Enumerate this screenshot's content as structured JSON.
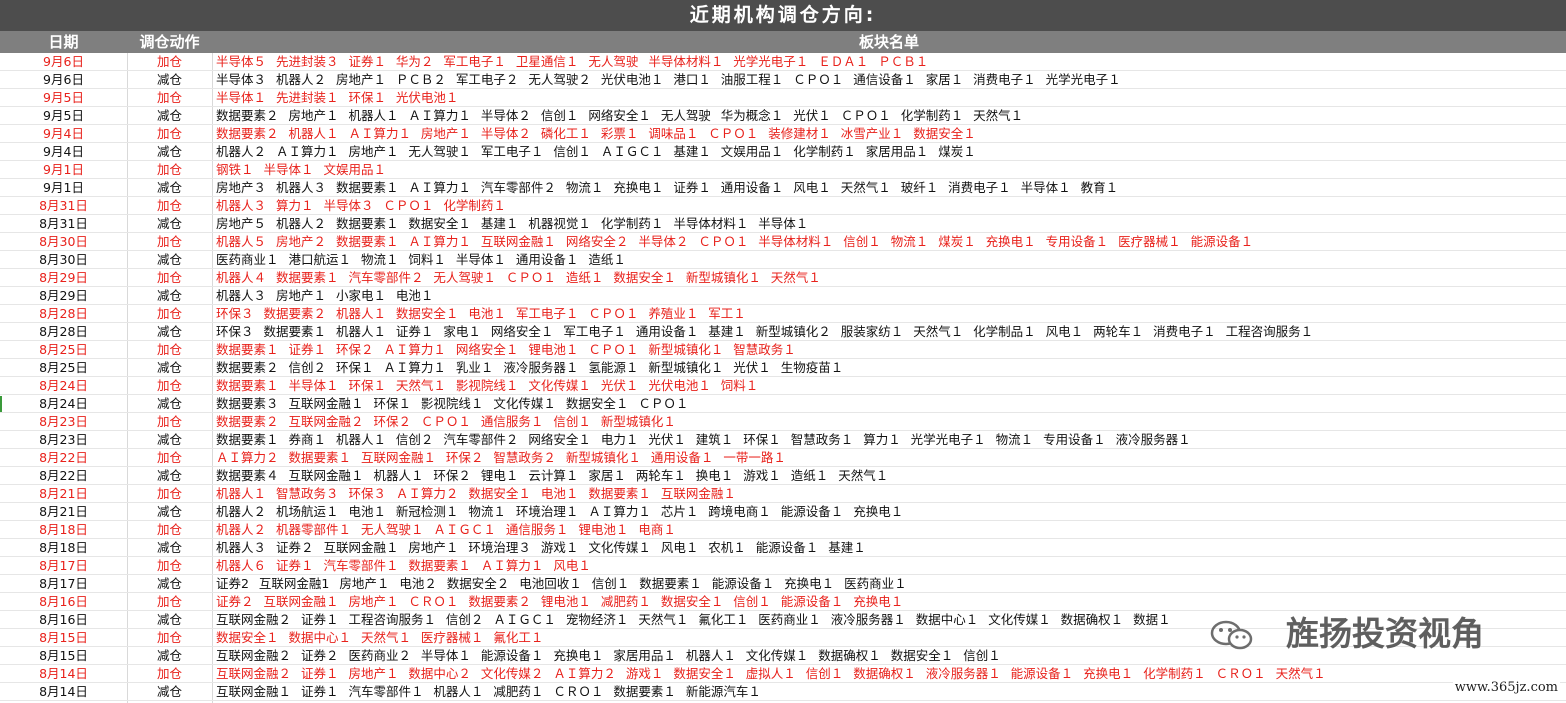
{
  "title": "近期机构调仓方向:",
  "headers": {
    "date": "日期",
    "action": "调仓动作",
    "sectors": "板块名单"
  },
  "colors": {
    "add": "#e8211b",
    "cut": "#111111",
    "title_bg": "#4d4d4d",
    "header_bg": "#7f7f7f"
  },
  "rows": [
    {
      "date": "9月6日",
      "action": "加仓",
      "type": "add",
      "sectors": "半导体５ 先进封装３ 证券１ 华为２ 军工电子１ 卫星通信１ 无人驾驶 半导体材料１ 光学光电子１ ＥＤＡ１ ＰＣＢ１"
    },
    {
      "date": "9月6日",
      "action": "减仓",
      "type": "cut",
      "sectors": "半导体３ 机器人２ 房地产１ ＰＣＢ２ 军工电子２ 无人驾驶２ 光伏电池１ 港口１ 油服工程１ ＣＰＯ１ 通信设备１ 家居１ 消费电子１ 光学光电子１"
    },
    {
      "date": "9月5日",
      "action": "加仓",
      "type": "add",
      "sectors": "半导体１ 先进封装１ 环保１ 光伏电池１"
    },
    {
      "date": "9月5日",
      "action": "减仓",
      "type": "cut",
      "sectors": "数据要素２ 房地产１ 机器人１ ＡＩ算力１ 半导体２ 信创１ 网络安全１ 无人驾驶 华为概念１ 光伏１ ＣＰＯ１ 化学制药１ 天然气１"
    },
    {
      "date": "9月4日",
      "action": "加仓",
      "type": "add",
      "sectors": "数据要素２ 机器人１ ＡＩ算力１ 房地产１ 半导体２ 磷化工１ 彩票１ 调味品１ ＣＰＯ１ 装修建材１ 冰雪产业１ 数据安全１"
    },
    {
      "date": "9月4日",
      "action": "减仓",
      "type": "cut",
      "sectors": "机器人２ ＡＩ算力１ 房地产１ 无人驾驶１ 军工电子１ 信创１ ＡＩＧＣ１ 基建１ 文娱用品１ 化学制药１ 家居用品１ 煤炭１"
    },
    {
      "date": "9月1日",
      "action": "加仓",
      "type": "add",
      "sectors": "钢铁１ 半导体１ 文娱用品１"
    },
    {
      "date": "9月1日",
      "action": "减仓",
      "type": "cut",
      "sectors": "房地产３ 机器人３ 数据要素１ ＡＩ算力１ 汽车零部件２ 物流１ 充换电１ 证券１ 通用设备１ 风电１ 天然气１ 玻纤１ 消费电子１ 半导体１ 教育１"
    },
    {
      "date": "8月31日",
      "action": "加仓",
      "type": "add",
      "sectors": "机器人３ 算力１ 半导体３ ＣＰＯ１ 化学制药１"
    },
    {
      "date": "8月31日",
      "action": "减仓",
      "type": "cut",
      "sectors": "房地产５ 机器人２ 数据要素１ 数据安全１ 基建１ 机器视觉１ 化学制药１ 半导体材料１ 半导体１"
    },
    {
      "date": "8月30日",
      "action": "加仓",
      "type": "add",
      "sectors": "机器人５ 房地产２ 数据要素１ ＡＩ算力１ 互联网金融１ 网络安全２ 半导体２ ＣＰＯ１ 半导体材料１ 信创１ 物流１ 煤炭１ 充换电１ 专用设备１ 医疗器械１ 能源设备１"
    },
    {
      "date": "8月30日",
      "action": "减仓",
      "type": "cut",
      "sectors": "医药商业１ 港口航运１ 物流１ 饲料１ 半导体１ 通用设备１ 造纸１"
    },
    {
      "date": "8月29日",
      "action": "加仓",
      "type": "add",
      "sectors": "机器人４ 数据要素１ 汽车零部件２ 无人驾驶１ ＣＰＯ１ 造纸１ 数据安全１ 新型城镇化１ 天然气１"
    },
    {
      "date": "8月29日",
      "action": "减仓",
      "type": "cut",
      "sectors": "机器人３ 房地产１ 小家电１ 电池１"
    },
    {
      "date": "8月28日",
      "action": "加仓",
      "type": "add",
      "sectors": "环保３ 数据要素２ 机器人１ 数据安全１ 电池１ 军工电子１ ＣＰＯ１ 养殖业１ 军工１"
    },
    {
      "date": "8月28日",
      "action": "减仓",
      "type": "cut",
      "sectors": "环保３ 数据要素１ 机器人１ 证券１ 家电１ 网络安全１ 军工电子１ 通用设备１ 基建１ 新型城镇化２ 服装家纺１ 天然气１ 化学制品１ 风电１ 两轮车１ 消费电子１ 工程咨询服务１"
    },
    {
      "date": "8月25日",
      "action": "加仓",
      "type": "add",
      "sectors": "数据要素１ 证券１ 环保２ ＡＩ算力１ 网络安全１ 锂电池１ ＣＰＯ１ 新型城镇化１ 智慧政务１"
    },
    {
      "date": "8月25日",
      "action": "减仓",
      "type": "cut",
      "sectors": "数据要素２ 信创２ 环保１ ＡＩ算力１ 乳业１ 液冷服务器１ 氢能源１ 新型城镇化１ 光伏１ 生物疫苗１"
    },
    {
      "date": "8月24日",
      "action": "加仓",
      "type": "add",
      "sectors": "数据要素１ 半导体１ 环保１ 天然气１ 影视院线１ 文化传媒１ 光伏１ 光伏电池１ 饲料１"
    },
    {
      "date": "8月24日",
      "action": "减仓",
      "type": "cut",
      "sectors": "数据要素３ 互联网金融１ 环保１ 影视院线１ 文化传媒１ 数据安全１ ＣＰＯ１"
    },
    {
      "date": "8月23日",
      "action": "加仓",
      "type": "add",
      "sectors": "数据要素２ 互联网金融２ 环保２ ＣＰＯ１ 通信服务１ 信创１ 新型城镇化１"
    },
    {
      "date": "8月23日",
      "action": "减仓",
      "type": "cut",
      "sectors": "数据要素１ 券商１ 机器人１ 信创２ 汽车零部件２ 网络安全１ 电力１ 光伏１ 建筑１ 环保１ 智慧政务１ 算力１ 光学光电子１ 物流１ 专用设备１ 液冷服务器１"
    },
    {
      "date": "8月22日",
      "action": "加仓",
      "type": "add",
      "sectors": "ＡＩ算力２ 数据要素１ 互联网金融１ 环保２ 智慧政务２ 新型城镇化１ 通用设备１ 一带一路１"
    },
    {
      "date": "8月22日",
      "action": "减仓",
      "type": "cut",
      "sectors": "数据要素４ 互联网金融１ 机器人１ 环保２ 锂电１ 云计算１ 家居１ 两轮车１ 换电１ 游戏１ 造纸１ 天然气１"
    },
    {
      "date": "8月21日",
      "action": "加仓",
      "type": "add",
      "sectors": "机器人１ 智慧政务３ 环保３ ＡＩ算力２ 数据安全１ 电池１ 数据要素１ 互联网金融１"
    },
    {
      "date": "8月21日",
      "action": "减仓",
      "type": "cut",
      "sectors": "机器人２ 机场航运１ 电池１ 新冠检测１ 物流１ 环境治理１ ＡＩ算力１ 芯片１ 跨境电商１ 能源设备１ 充换电１"
    },
    {
      "date": "8月18日",
      "action": "加仓",
      "type": "add",
      "sectors": "机器人２ 机器零部件１ 无人驾驶１ ＡＩＧＣ１ 通信服务１ 锂电池１ 电商１"
    },
    {
      "date": "8月18日",
      "action": "减仓",
      "type": "cut",
      "sectors": "机器人３ 证券２ 互联网金融１ 房地产１ 环境治理３ 游戏１ 文化传媒１ 风电１ 农机１ 能源设备１ 基建１"
    },
    {
      "date": "8月17日",
      "action": "加仓",
      "type": "add",
      "sectors": "机器人６ 证券１ 汽车零部件１ 数据要素１ ＡＩ算力１ 风电１"
    },
    {
      "date": "8月17日",
      "action": "减仓",
      "type": "cut",
      "sectors": "证券2 互联网金融1 房地产１ 电池２ 数据安全２ 电池回收１ 信创１ 数据要素１ 能源设备１ 充换电１ 医药商业１"
    },
    {
      "date": "8月16日",
      "action": "加仓",
      "type": "add",
      "sectors": "证券２ 互联网金融１ 房地产１ ＣＲＯ１ 数据要素２ 锂电池１ 减肥药１ 数据安全１ 信创１ 能源设备１ 充换电１"
    },
    {
      "date": "8月16日",
      "action": "减仓",
      "type": "cut",
      "sectors": "互联网金融２ 证券１ 工程咨询服务１ 信创２ ＡＩＧＣ１ 宠物经济１ 天然气１ 氟化工１ 医药商业１ 液冷服务器１ 数据中心１ 文化传媒１ 数据确权１ 数据１"
    },
    {
      "date": "8月15日",
      "action": "加仓",
      "type": "add",
      "sectors": "数据安全１ 数据中心１ 天然气１ 医疗器械１ 氟化工１"
    },
    {
      "date": "8月15日",
      "action": "减仓",
      "type": "cut",
      "sectors": "互联网金融２ 证券２ 医药商业２ 半导体１ 能源设备１ 充换电１ 家居用品１ 机器人１ 文化传媒１ 数据确权１ 数据安全１ 信创１"
    },
    {
      "date": "8月14日",
      "action": "加仓",
      "type": "add",
      "sectors": "互联网金融２ 证券１ 房地产１ 数据中心２ 文化传媒２ ＡＩ算力２ 游戏１ 数据安全１ 虚拟人１ 信创１ 数据确权１ 液冷服务器１ 能源设备１ 充换电１ 化学制药１ ＣＲＯ１ 天然气１"
    },
    {
      "date": "8月14日",
      "action": "减仓",
      "type": "cut",
      "sectors": "互联网金融１ 证券１ 汽车零部件１ 机器人１ 减肥药１ ＣＲＯ１ 数据要素１ 新能源汽车１"
    }
  ],
  "watermark": {
    "icon": "wechat-icon",
    "text": "旌扬投资视角"
  },
  "footer_url": "www.365jz.com"
}
